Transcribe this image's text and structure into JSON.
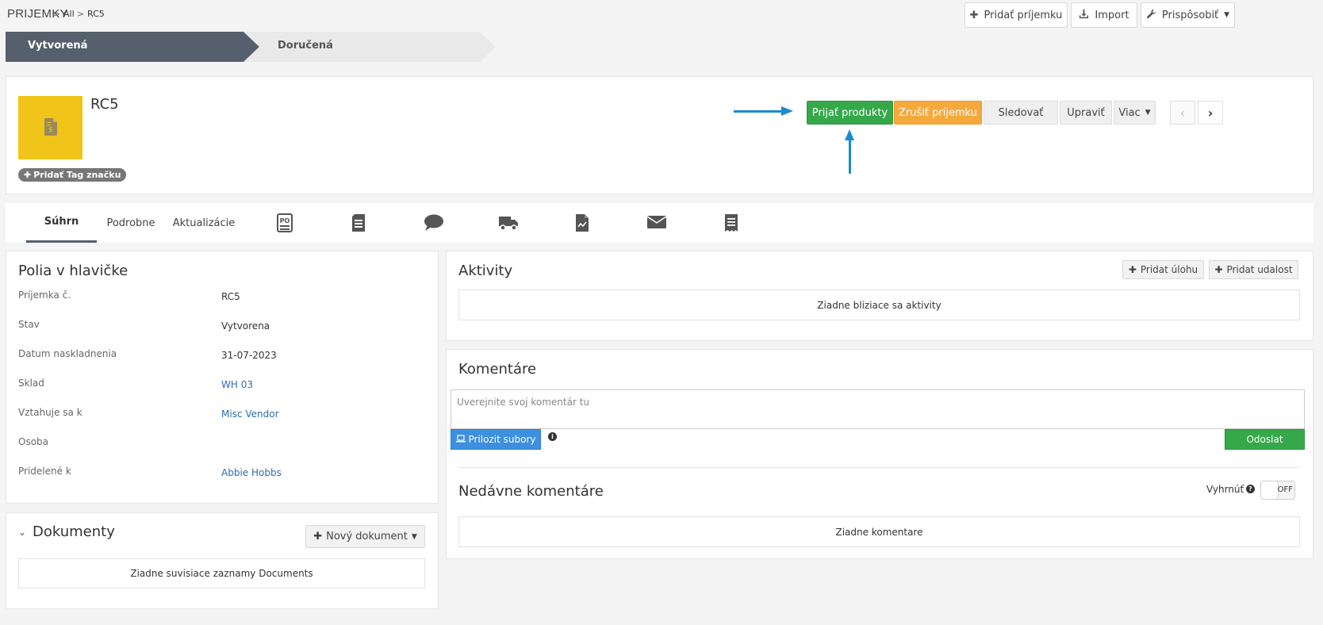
{
  "breadcrumb": {
    "module": "PRIJEMKY",
    "sep1": ">",
    "all": "All",
    "sep2": ">",
    "current": "RC5"
  },
  "toolbar": {
    "add_label": "Pridať príjemku",
    "add_icon": "plus-icon",
    "import_label": "Import",
    "import_icon": "download-icon",
    "customize_label": "Prispôsobiť",
    "customize_icon": "wrench-icon"
  },
  "stages": [
    {
      "label": "Vytvorená",
      "active": true
    },
    {
      "label": "Doručená",
      "active": false
    }
  ],
  "record": {
    "title": "RC5",
    "add_tag_label": "Pridať Tag značku",
    "logo_color": "#f0c419"
  },
  "actions": {
    "receive": "Prijať produkty",
    "cancel": "Zrušiť príjemku",
    "follow": "Sledovať",
    "edit": "Upraviť",
    "more": "Viac"
  },
  "tabs": {
    "summary": "Súhrn",
    "details": "Podrobne",
    "updates": "Aktualizácie",
    "icons": [
      "purchase-order-icon",
      "document-list-icon",
      "comment-icon",
      "truck-icon",
      "invoice-icon",
      "envelope-icon",
      "receipt-icon"
    ]
  },
  "header_fields": {
    "title": "Polia v hlavičke",
    "rows": [
      {
        "label": "Príjemka č.",
        "value": "RC5",
        "link": false
      },
      {
        "label": "Stav",
        "value": "Vytvorena",
        "link": false
      },
      {
        "label": "Datum naskladnenia",
        "value": "31-07-2023",
        "link": false
      },
      {
        "label": "Sklad",
        "value": "WH 03",
        "link": true
      },
      {
        "label": "Vztahuje sa k",
        "value": "Misc Vendor",
        "link": true
      },
      {
        "label": "Osoba",
        "value": "",
        "link": false
      },
      {
        "label": "Pridelené k",
        "value": "Abbie Hobbs",
        "link": true
      }
    ]
  },
  "documents": {
    "title": "Dokumenty",
    "new_label": "Nový dokument",
    "empty": "Ziadne suvisiace zaznamy Documents"
  },
  "activities": {
    "title": "Aktivity",
    "add_task": "Pridat úlohu",
    "add_event": "Pridat udalost",
    "empty": "Ziadne bliziace sa aktivity"
  },
  "comments": {
    "title": "Komentáre",
    "placeholder": "Uverejnite svoj komentár tu",
    "attach_label": "Prilozit subory",
    "send_label": "Odoslat",
    "recent_title": "Nedávne komentáre",
    "collapse_label": "Vyhrnúť",
    "toggle_state": "OFF",
    "empty": "Ziadne komentare"
  },
  "colors": {
    "accent_green": "#35a84a",
    "accent_orange": "#f5a93b",
    "arrow_blue": "#1a8bd0",
    "stage_active": "#55606c"
  }
}
